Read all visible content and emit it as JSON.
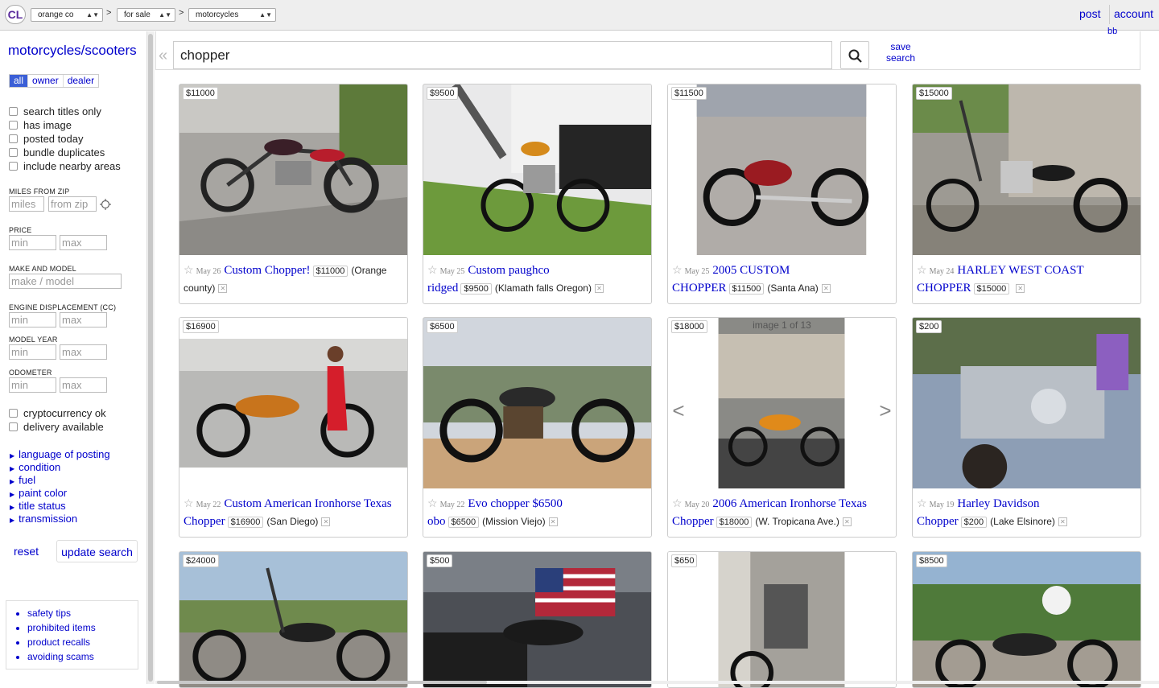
{
  "topbar": {
    "logo": "CL",
    "area": "orange co",
    "section": "for sale",
    "category": "motorcycles",
    "separator": ">",
    "post": "post",
    "account": "account"
  },
  "sidebar": {
    "title": "motorcycles/scooters",
    "seller_types": [
      "all",
      "owner",
      "dealer"
    ],
    "checkboxes": [
      "search titles only",
      "has image",
      "posted today",
      "bundle duplicates",
      "include nearby areas"
    ],
    "miles_label": "MILES FROM ZIP",
    "miles_placeholder": "miles",
    "zip_placeholder": "from zip",
    "price_label": "PRICE",
    "make_label": "MAKE AND MODEL",
    "make_placeholder": "make / model",
    "engine_label": "ENGINE DISPLACEMENT (CC)",
    "year_label": "MODEL YEAR",
    "odometer_label": "ODOMETER",
    "min": "min",
    "max": "max",
    "checkboxes2": [
      "cryptocurrency ok",
      "delivery available"
    ],
    "expanders": [
      "language of posting",
      "condition",
      "fuel",
      "paint color",
      "title status",
      "transmission"
    ],
    "reset": "reset",
    "update": "update search",
    "tips": [
      "safety tips",
      "prohibited items",
      "product recalls",
      "avoiding scams"
    ]
  },
  "search": {
    "query": "chopper",
    "collapse": "«",
    "save": "save search",
    "bb": "bb"
  },
  "listings": [
    {
      "price": "$11000",
      "date": "May 26",
      "title": "Custom Chopper!",
      "hood": "(Orange county)"
    },
    {
      "price": "$9500",
      "date": "May 25",
      "title": "Custom paughco ridged",
      "hood": "(Klamath falls Oregon)"
    },
    {
      "price": "$11500",
      "date": "May 25",
      "title": "2005 CUSTOM CHOPPER",
      "hood": "(Santa Ana)"
    },
    {
      "price": "$15000",
      "date": "May 24",
      "title": "HARLEY WEST COAST CHOPPER",
      "hood": ""
    },
    {
      "price": "$16900",
      "date": "May 22",
      "title": "Custom American Ironhorse Texas Chopper",
      "hood": "(San Diego)"
    },
    {
      "price": "$6500",
      "date": "May 22",
      "title": "Evo chopper $6500 obo",
      "hood": "(Mission Viejo)"
    },
    {
      "price": "$18000",
      "date": "May 20",
      "title": "2006 American Ironhorse Texas Chopper",
      "hood": "(W. Tropicana Ave.)",
      "image_counter": "image 1 of 13"
    },
    {
      "price": "$200",
      "date": "May 19",
      "title": "Harley Davidson Chopper",
      "hood": "(Lake Elsinore)"
    },
    {
      "price": "$24000"
    },
    {
      "price": "$500"
    },
    {
      "price": "$650"
    },
    {
      "price": "$8500"
    }
  ]
}
